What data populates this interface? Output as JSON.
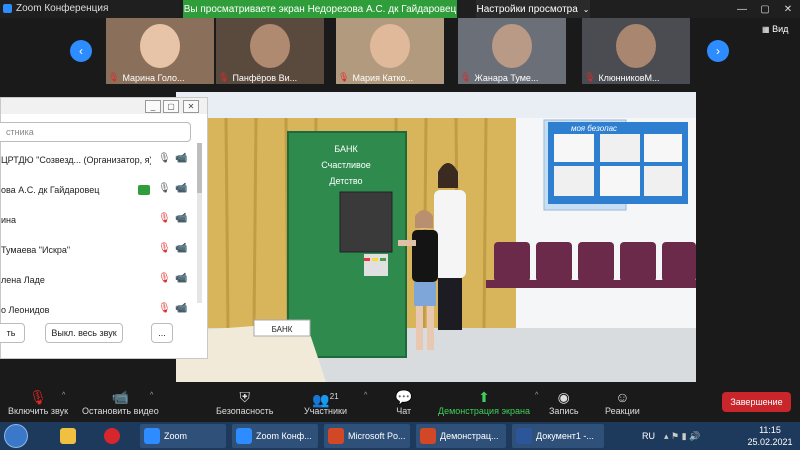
{
  "window": {
    "title": "Zoom Конференция",
    "share_banner": "Вы просматриваете экран Недорезова А.С. дк Гайдаровец",
    "view_options": "Настройки просмотра",
    "minimize": "—",
    "restore": "▢",
    "close": "✕"
  },
  "gallery": {
    "prev": "‹",
    "next": "›",
    "view_label": "Вид",
    "participants": [
      {
        "name": "Марина Голо..."
      },
      {
        "name": "Панфёров Ви..."
      },
      {
        "name": "Мария Катко..."
      },
      {
        "name": "Жанара Туме..."
      },
      {
        "name": "КлюнниковМ..."
      }
    ]
  },
  "video": {
    "sign_bank": "БАНК",
    "sign_line1": "БАНК",
    "sign_line2": "Счастливое",
    "sign_line3": "Детство",
    "board_text": "моя безопас",
    "side_text": "Счастливое"
  },
  "participants_panel": {
    "search_placeholder": "стника",
    "rows": [
      {
        "name": "ЦРТДЮ \"Созвезд... (Организатор, я)",
        "mic": "🎙",
        "cam": "📹"
      },
      {
        "name": "ова А.С. дк Гайдаровец",
        "mic": "🎙",
        "cam": "📹"
      },
      {
        "name": "ина",
        "mic": "🎙",
        "cam": "📹"
      },
      {
        "name": "Тумаева \"Искра\"",
        "mic": "🎙",
        "cam": "📹"
      },
      {
        "name": "лена Ладе",
        "mic": "🎙",
        "cam": "📹"
      },
      {
        "name": "о Леонидов",
        "mic": "🎙",
        "cam": "📹"
      }
    ],
    "btn_left": "ть",
    "btn_mute_all": "Выкл. весь звук",
    "btn_more": "..."
  },
  "toolbar": {
    "unmute": "Включить звук",
    "start_video": "Остановить видео",
    "security": "Безопасность",
    "participants": "Участники",
    "participants_count": "21",
    "chat": "Чат",
    "share": "Демонстрация экрана",
    "record": "Запись",
    "reactions": "Реакции",
    "end": "Завершение"
  },
  "taskbar": {
    "zoom": "Zoom",
    "zoom_conf": "Zoom Конф...",
    "ppt": "Microsoft Po...",
    "demo": "Демонстрац...",
    "doc": "Документ1 -...",
    "lang": "RU",
    "time": "11:15",
    "date": "25.02.2021"
  },
  "colors": {
    "zoom_blue": "#2d8cff",
    "banner_green": "#2f9e3a",
    "end_red": "#c8262b",
    "taskbar": "#1d3a5c"
  }
}
